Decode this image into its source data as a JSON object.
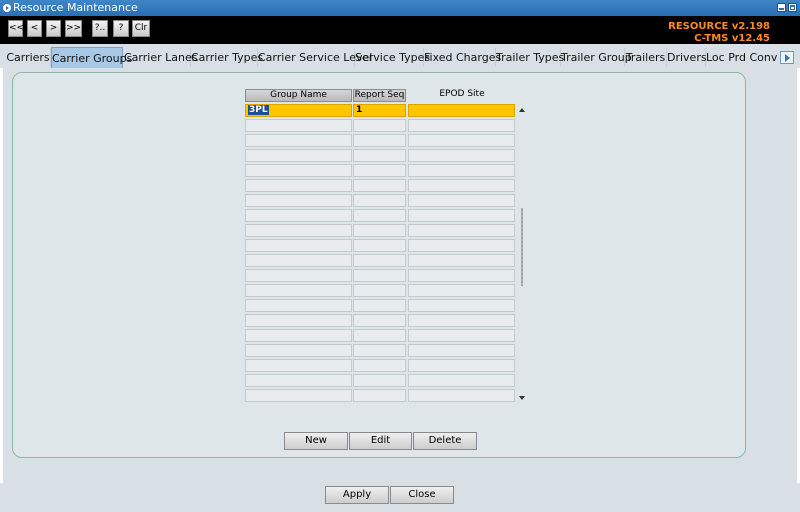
{
  "window": {
    "title": "Resource Maintenance"
  },
  "toolbar": {
    "buttons": [
      "<<",
      "<",
      ">",
      ">>",
      "?..",
      "?",
      "Clr"
    ],
    "version_resource": "RESOURCE v2.198",
    "version_ctms": "C-TMS v12.45"
  },
  "tabs": [
    "Carriers",
    "Carrier Groups",
    "Carrier Lanes",
    "Carrier Types",
    "Carrier Service Level",
    "Service Types",
    "Fixed Charges",
    "Trailer Types",
    "Trailer Group",
    "Trailers",
    "Drivers",
    "Loc Prd Conv"
  ],
  "active_tab": "Carrier Groups",
  "grid": {
    "headers": {
      "group_name": "Group Name",
      "report_seq": "Report Seq",
      "epod_site": "EPOD Site"
    },
    "rows": [
      {
        "group_name": "3PL",
        "report_seq": "1",
        "epod_site": ""
      }
    ],
    "visible_rows": 20
  },
  "actions": {
    "new": "New",
    "edit": "Edit",
    "delete": "Delete"
  },
  "footer": {
    "apply": "Apply",
    "close": "Close"
  },
  "colors": {
    "title_bar": "#2a6fb6",
    "selected_row": "#ffc600",
    "selected_text_bg": "#1f4d96",
    "version_text": "#ff8a1f",
    "active_tab": "#a9c8e6"
  }
}
